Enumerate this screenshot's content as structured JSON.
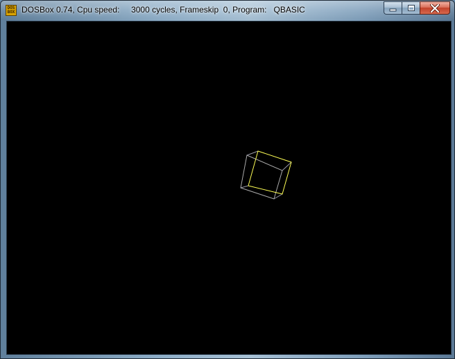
{
  "window": {
    "title": "DOSBox 0.74, Cpu speed:     3000 cycles, Frameskip  0, Program:   QBASIC",
    "app_icon_text_top": "DOS",
    "app_icon_text_bottom": "BOX",
    "controls": {
      "minimize_icon": "minimize-icon",
      "maximize_icon": "maximize-icon",
      "close_icon": "close-icon"
    }
  },
  "screen": {
    "background_color": "#000000",
    "cube": {
      "front_face_color": "#ffff55",
      "back_face_color": "#aaaaaa",
      "edge_color": "#9a9aa8"
    }
  }
}
